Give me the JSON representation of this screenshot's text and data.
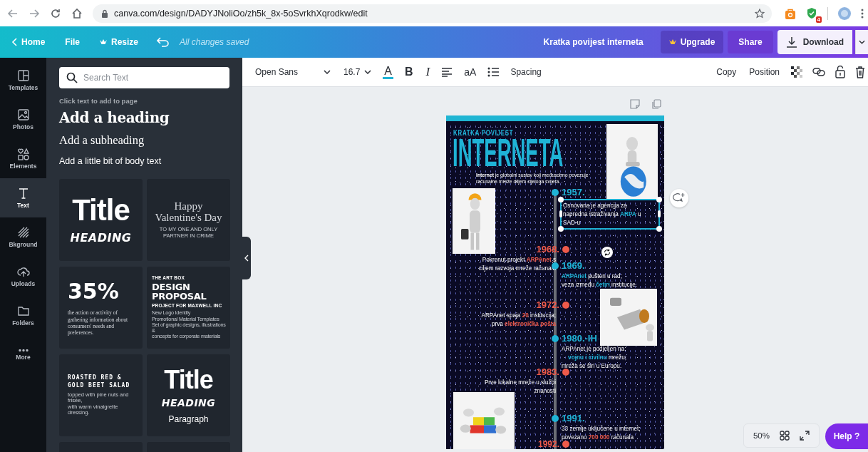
{
  "browser": {
    "url": "canva.com/design/DADYJNoliOo/zh5k_8x-5oSvrkhXqrodkw/edit",
    "extension_badge": "4"
  },
  "topbar": {
    "home": "Home",
    "file": "File",
    "resize": "Resize",
    "save_status": "All changes saved",
    "design_title": "Kratka povijest interneta",
    "upgrade": "Upgrade",
    "share": "Share",
    "download": "Download"
  },
  "rail": [
    {
      "label": "Templates",
      "selected": false
    },
    {
      "label": "Photos",
      "selected": false
    },
    {
      "label": "Elements",
      "selected": false
    },
    {
      "label": "Text",
      "selected": true
    },
    {
      "label": "Bkground",
      "selected": false
    },
    {
      "label": "Uploads",
      "selected": false
    },
    {
      "label": "Folders",
      "selected": false
    },
    {
      "label": "More",
      "selected": false
    }
  ],
  "panel": {
    "search_placeholder": "Search Text",
    "hint": "Click text to add to page",
    "heading": "Add a heading",
    "subheading": "Add a subheading",
    "body": "Add a little bit of body text",
    "cards": [
      {
        "lines": [
          {
            "kind": "title",
            "text": "Title"
          },
          {
            "kind": "heading",
            "text": "HEADING"
          }
        ]
      },
      {
        "lines": [
          {
            "kind": "script",
            "text": "Happy\nValentine's Day"
          },
          {
            "kind": "tiny",
            "text": "TO MY ONE AND ONLY PARTNER IN CRIME"
          }
        ]
      },
      {
        "lines": [
          {
            "kind": "stat",
            "text": "35%"
          },
          {
            "kind": "serif-small",
            "text": "the action or activity of gathering information about consumers' needs and preferences."
          }
        ]
      },
      {
        "lines": [
          {
            "kind": "caps-small",
            "text": "THE ART BOX"
          },
          {
            "kind": "display",
            "text": "DESIGN\nPROPOSAL"
          },
          {
            "kind": "caps-small",
            "text": "PROJECT FOR MAXWELL INC"
          },
          {
            "kind": "tiny-left",
            "text": "New Logo Identity\nPromotional Material Templates\nSet of graphic designs, illustrations &\nconcepts for corporate materials"
          }
        ]
      },
      {
        "lines": [
          {
            "kind": "mono",
            "text": "ROASTED RED &\nGOLD BEET SALAD"
          },
          {
            "kind": "tiny-left",
            "text": "topped with pine nuts and frisée,\nwith warm vinaigrette dressing."
          }
        ]
      },
      {
        "lines": [
          {
            "kind": "title",
            "text": "Title"
          },
          {
            "kind": "heading",
            "text": "HEADING"
          },
          {
            "kind": "paragraph",
            "text": "Paragraph"
          }
        ]
      }
    ]
  },
  "toolbar": {
    "font": "Open Sans",
    "size": "16.7",
    "color_glyph": "A",
    "bold_glyph": "B",
    "italic_glyph": "I",
    "case_glyph": "aA",
    "spacing": "Spacing",
    "copy": "Copy",
    "position": "Position"
  },
  "design": {
    "subtitle": "KRATKA POVIJEST",
    "title": "INTERNETA",
    "intro": "**Internet** je globalni sustav koji međusobno povezuje\nračunalne mreže diljem cijeloga svijeta.",
    "timeline": [
      {
        "year": "1957.",
        "kind": "right",
        "color": "#1fb3d6",
        "selected": true,
        "parts": [
          {
            "text": "Osnovana je agencija za\nnapredna istraživanja "
          },
          {
            "text": "ARPA",
            "color": "#1fb3d6"
          },
          {
            "text": " u\nSAD-u"
          }
        ]
      },
      {
        "year": "1968.",
        "kind": "left",
        "color": "#ee5a4a",
        "selected": false,
        "parts": [
          {
            "text": "Pokrenut projekt "
          },
          {
            "text": "ARPAnet",
            "color": "#ee5a4a"
          },
          {
            "text": " s\nciljem razvoja mreže računala"
          }
        ]
      },
      {
        "year": "1969.",
        "kind": "right",
        "color": "#1fb3d6",
        "selected": false,
        "parts": [
          {
            "text": "ARPAnet",
            "color": "#1fb3d6"
          },
          {
            "text": " pušten u rad;\nveza između "
          },
          {
            "text": "četiri",
            "color": "#1fb3d6"
          },
          {
            "text": " institucije."
          }
        ]
      },
      {
        "year": "1972.",
        "kind": "left",
        "color": "#ee5a4a",
        "selected": false,
        "parts": [
          {
            "text": "ARPAnet spaja "
          },
          {
            "text": "20",
            "color": "#ee5a4a"
          },
          {
            "text": " institucija;\nprva "
          },
          {
            "text": "elektronička pošta",
            "color": "#ee5a4a"
          }
        ]
      },
      {
        "year": "1980.-IH",
        "kind": "right",
        "color": "#1fb3d6",
        "selected": false,
        "parts": [
          {
            "text": "ARPAnet je podjeljen na:\n    "
          },
          {
            "text": "vojnu i civilnu",
            "color": "#1fb3d6"
          },
          {
            "text": " mrežu;\nmreža se širi u Europu."
          }
        ]
      },
      {
        "year": "1983.",
        "kind": "left",
        "color": "#ee5a4a",
        "selected": false,
        "parts": [
          {
            "text": "Prve lokalne mreže u službi\nznanosti"
          }
        ]
      },
      {
        "year": "1991.",
        "kind": "right",
        "color": "#1fb3d6",
        "selected": false,
        "parts": [
          {
            "text": "33 zemlje uključene u internet;\npovezano "
          },
          {
            "text": "700 000",
            "color": "#ee5a4a"
          },
          {
            "text": " računala"
          }
        ]
      },
      {
        "year": "1992.",
        "kind": "left",
        "color": "#ee5a4a"
      }
    ]
  },
  "zoom": "50%",
  "help": "Help ?"
}
